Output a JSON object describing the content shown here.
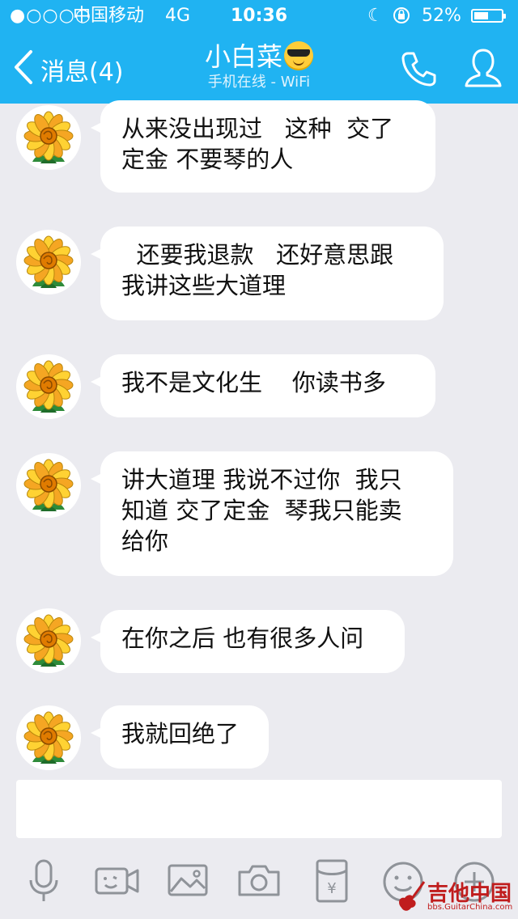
{
  "status_bar": {
    "signal": "●○○○○",
    "carrier": "中国移动",
    "network": "4G",
    "time": "10:36",
    "battery": "52%",
    "battery_level": 0.52
  },
  "nav": {
    "back_label": "消息(4)",
    "contact_name": "小白菜",
    "contact_status": "手机在线 - WiFi"
  },
  "messages": [
    {
      "text": "从来没出现过   这种  交了\n定金 不要琴的人"
    },
    {
      "text": "  还要我退款   还好意思跟\n我讲这些大道理"
    },
    {
      "text": "我不是文化生    你读书多"
    },
    {
      "text": "讲大道理 我说不过你  我只\n知道 交了定金  琴我只能卖\n给你"
    },
    {
      "text": "在你之后 也有很多人问"
    },
    {
      "text": "我就回绝了"
    }
  ],
  "input": {
    "value": ""
  },
  "toolbar": {
    "icons": [
      "microphone-icon",
      "video-icon",
      "image-icon",
      "camera-icon",
      "red-packet-icon",
      "emoji-icon",
      "plus-icon"
    ],
    "red_packet_symbol": "¥"
  },
  "watermark": {
    "text": "吉他中国",
    "sub": "bbs.GuitarChina.com"
  },
  "colors": {
    "accent": "#20b3f2",
    "background": "#ebebf0"
  }
}
